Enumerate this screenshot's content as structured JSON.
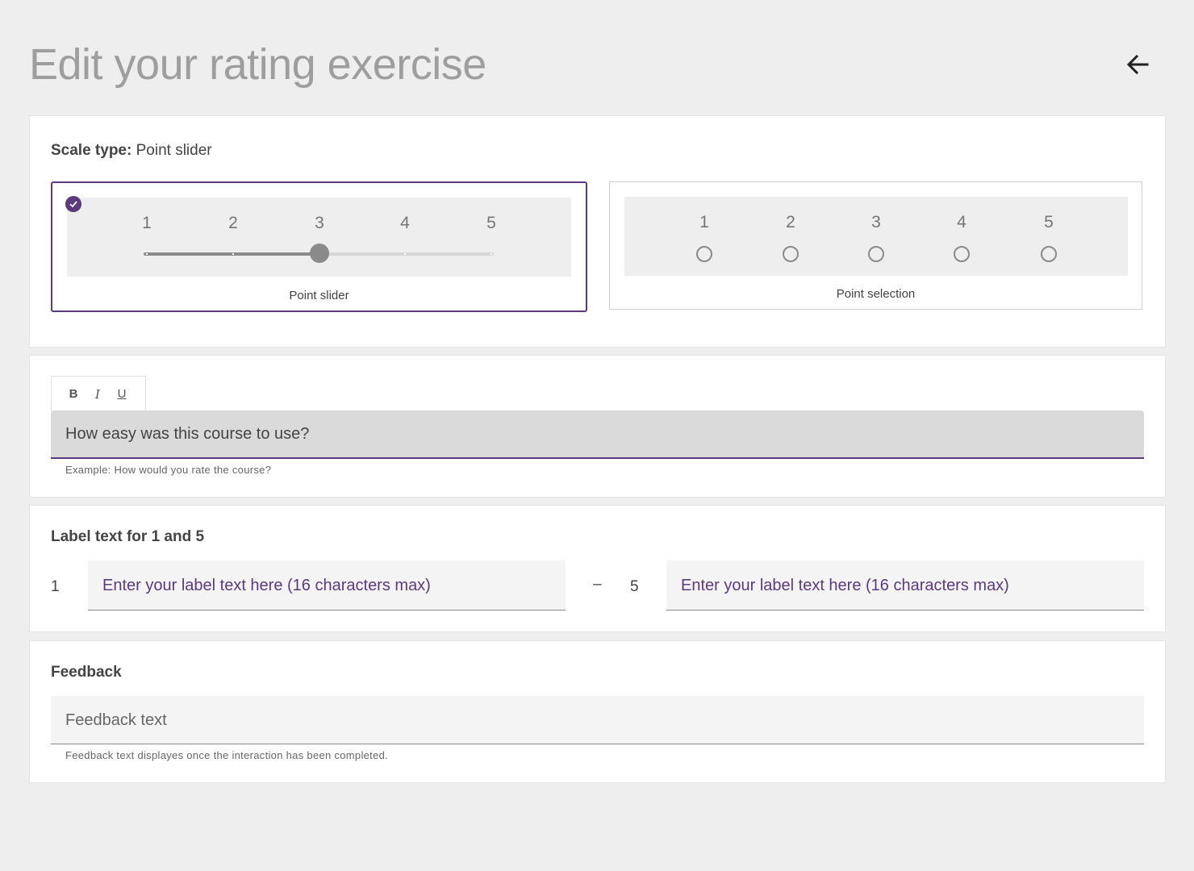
{
  "page": {
    "title": "Edit your rating exercise"
  },
  "scale": {
    "heading_label": "Scale type:",
    "heading_value": "Point slider",
    "options": [
      {
        "caption": "Point slider",
        "selected": true,
        "numbers": [
          "1",
          "2",
          "3",
          "4",
          "5"
        ],
        "slider_value": 3
      },
      {
        "caption": "Point selection",
        "selected": false,
        "numbers": [
          "1",
          "2",
          "3",
          "4",
          "5"
        ]
      }
    ]
  },
  "question": {
    "toolbar": {
      "bold": "B",
      "italic": "I",
      "underline": "U"
    },
    "value": "How easy was this course to use?",
    "hint": "Example: How would you rate the course?"
  },
  "labels": {
    "title": "Label text for 1 and 5",
    "left_num": "1",
    "separator": "–",
    "right_num": "5",
    "left_placeholder": "Enter your label text here (16 characters max)",
    "right_placeholder": "Enter your label text here (16 characters max)"
  },
  "feedback": {
    "title": "Feedback",
    "placeholder": "Feedback text",
    "hint": "Feedback text displayes once the interaction has been completed."
  },
  "colors": {
    "accent": "#5b3a7e",
    "background": "#eeeeee"
  },
  "icons": {
    "back": "arrow-left-icon",
    "selected": "check-circle-icon"
  }
}
